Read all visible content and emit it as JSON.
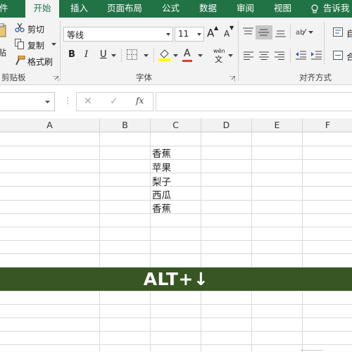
{
  "ribbon_tabs": {
    "file": "件",
    "home": "开始",
    "insert": "插入",
    "page_layout": "页面布局",
    "formulas": "公式",
    "data": "数据",
    "review": "审阅",
    "view": "视图",
    "tell_me": "告诉我"
  },
  "clipboard": {
    "paste": "贴",
    "cut": "剪切",
    "copy": "复制",
    "format_painter": "格式刷",
    "group_label": "剪贴板"
  },
  "font": {
    "font_name": "等线",
    "font_size": "11",
    "bold": "B",
    "italic": "I",
    "underline": "U",
    "phonetic_top": "wén",
    "phonetic_bottom": "文",
    "font_color_letter": "A",
    "grow_letter": "A",
    "shrink_letter": "A",
    "group_label": "字体",
    "fill_color": "#ffff00",
    "font_color": "#e03c31"
  },
  "alignment": {
    "group_label": "对齐方式",
    "wrap_label": "自",
    "merge_label": "合"
  },
  "formula_bar": {
    "cancel": "✕",
    "enter": "✓",
    "fx": "fx",
    "content": ""
  },
  "columns": [
    "A",
    "B",
    "C",
    "D",
    "E",
    "F"
  ],
  "cells_c": [
    "香蕉",
    "苹果",
    "梨子",
    "西瓜",
    "香蕉"
  ],
  "banner_text": "ALT+↓",
  "colors": {
    "ribbon_green": "#217346",
    "banner_green": "#375623"
  }
}
